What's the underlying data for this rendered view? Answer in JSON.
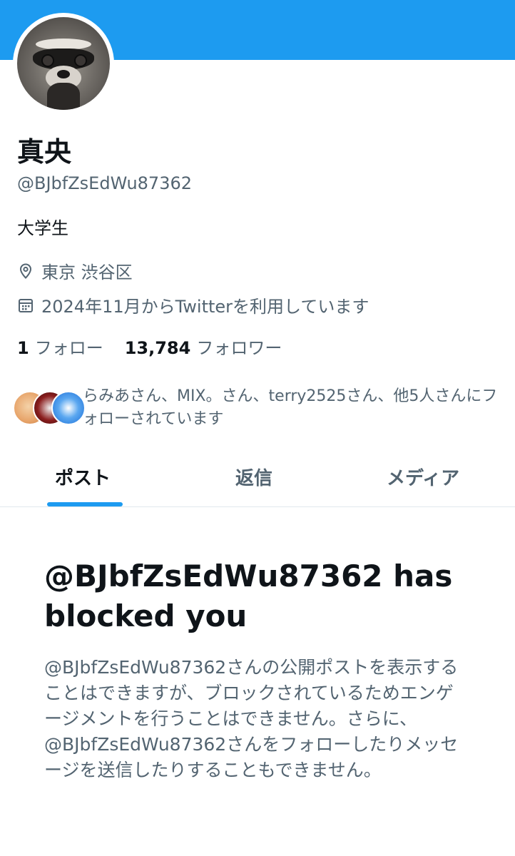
{
  "profile": {
    "name": "真央",
    "handle": "@BJbfZsEdWu87362",
    "bio": "大学生",
    "location": "東京 渋谷区",
    "joined": "2024年11月からTwitterを利用しています",
    "following_count": "1",
    "following_label": "フォロー",
    "followers_count": "13,784",
    "followers_label": "フォロワー",
    "followed_by_text": "らみあさん、MIX。さん、terry2525さん、他5人さんにフォローされています"
  },
  "tabs": [
    {
      "label": "ポスト"
    },
    {
      "label": "返信"
    },
    {
      "label": "メディア"
    }
  ],
  "blocked": {
    "title": "@BJbfZsEdWu87362 has blocked you",
    "body": "@BJbfZsEdWu87362さんの公開ポストを表示することはできますが、ブロックされているためエンゲージメントを行うことはできません。さらに、@BJbfZsEdWu87362さんをフォローしたりメッセージを送信したりすることもできません。"
  },
  "colors": {
    "accent": "#1d9bf0",
    "text_primary": "#0f1419",
    "text_secondary": "#536471"
  },
  "icons": {
    "location": "location-pin-icon",
    "calendar": "calendar-icon"
  }
}
